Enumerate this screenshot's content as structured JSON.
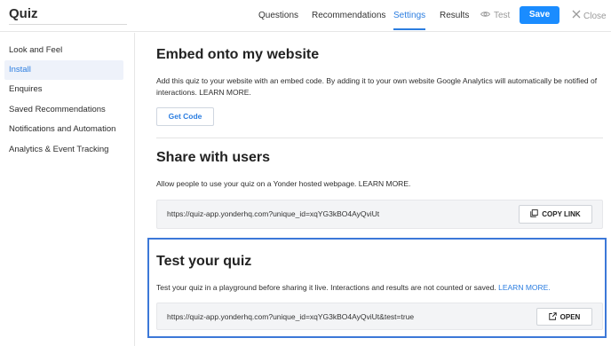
{
  "app": {
    "title": "Quiz"
  },
  "nav": {
    "tabs": [
      {
        "label": "Questions"
      },
      {
        "label": "Recommendations"
      },
      {
        "label": "Settings"
      },
      {
        "label": "Results"
      }
    ],
    "test_label": "Test",
    "save_label": "Save",
    "close_label": "Close"
  },
  "sidebar": {
    "items": [
      {
        "label": "Look and Feel"
      },
      {
        "label": "Install"
      },
      {
        "label": "Enquires"
      },
      {
        "label": "Saved Recommendations"
      },
      {
        "label": "Notifications and Automation"
      },
      {
        "label": "Analytics & Event Tracking"
      }
    ]
  },
  "embed": {
    "title": "Embed onto my website",
    "description": "Add this quiz to your website with an embed code. By adding it to your own website Google Analytics will automatically be notified of interactions. LEARN MORE.",
    "button_label": "Get Code"
  },
  "share": {
    "title": "Share with users",
    "description": "Allow people to use your quiz on a Yonder hosted webpage. LEARN MORE.",
    "url": "https://quiz-app.yonderhq.com?unique_id=xqYG3kBO4AyQviUt",
    "button_label": "COPY LINK"
  },
  "test": {
    "title": "Test your quiz",
    "description": "Test your quiz in a playground before sharing it live. Interactions and results are not counted or saved.",
    "learn_more": "LEARN MORE.",
    "url": "https://quiz-app.yonderhq.com?unique_id=xqYG3kBO4AyQviUt&test=true",
    "button_label": "OPEN"
  },
  "colors": {
    "accent": "#2b7de0",
    "save": "#1a8cff",
    "highlight_border": "#3c78d8"
  },
  "icons": {
    "test": "eye-icon",
    "close": "close-icon",
    "copy": "copy-icon",
    "open": "external-link-icon"
  }
}
